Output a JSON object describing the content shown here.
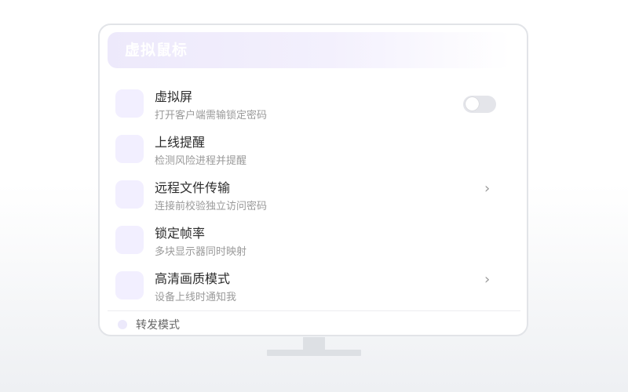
{
  "header": {
    "title": "虚拟鼠标"
  },
  "settings": [
    {
      "title": "虚拟屏",
      "subtitle": "打开客户端需输锁定密码",
      "control": "toggle",
      "toggle_on": false
    },
    {
      "title": "上线提醒",
      "subtitle": "检测风险进程并提醒",
      "control": "none"
    },
    {
      "title": "远程文件传输",
      "subtitle": "连接前校验独立访问密码",
      "control": "chevron",
      "chevron": "›"
    },
    {
      "title": "锁定帧率",
      "subtitle": "多块显示器同时映射",
      "control": "none"
    },
    {
      "title": "高清画质模式",
      "subtitle": "设备上线时通知我",
      "control": "chevron",
      "chevron": "›"
    }
  ],
  "footer": {
    "label": "转发模式"
  },
  "colors": {
    "accent_tint": "#f2efff",
    "toggle_off": "#e4e5ea",
    "monitor_border": "#e2e4e8",
    "stand": "#dde0e4"
  }
}
